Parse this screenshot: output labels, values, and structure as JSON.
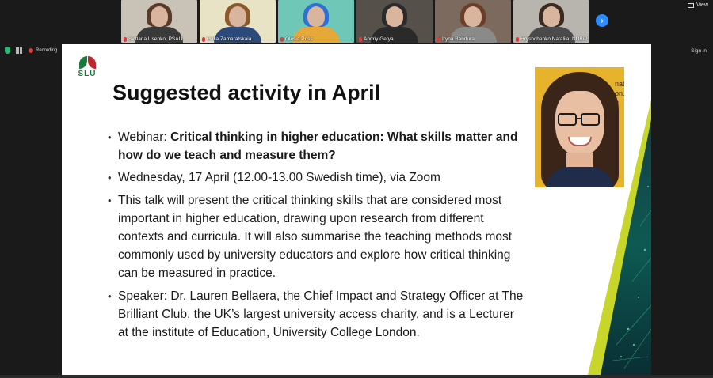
{
  "window": {
    "view_label": "View",
    "sign_in": "Sign in",
    "recording_label": "Recording"
  },
  "participants": [
    {
      "name": "Svitlana Usenko, PSAU",
      "bg": "#c9c2b6",
      "hair": "#5a3b2a",
      "body": "#3a3a3a"
    },
    {
      "name": "Galia Zamaratskaia",
      "bg": "#e9e3c6",
      "hair": "#8a5a2b",
      "body": "#2b4a7a"
    },
    {
      "name": "Olesia Priss",
      "bg": "#6fc7b8",
      "hair": "#2f6fd6",
      "body": "#e7a83a"
    },
    {
      "name": "Andriy Getya",
      "bg": "#55504a",
      "hair": "#2b2b2b",
      "body": "#2a2a2a"
    },
    {
      "name": "Iryna Bandura",
      "bg": "#7b6a5d",
      "hair": "#6a3e2a",
      "body": "#8a8a88"
    },
    {
      "name": "Hryshchenko Nataliia, NUBiP",
      "bg": "#b8b4ae",
      "hair": "#3a2b22",
      "body": "#4a4a4a"
    }
  ],
  "slide": {
    "logo_text": "SLU",
    "title": "Suggested activity in April",
    "webinar_prefix": "Webinar: ",
    "webinar_title": "Critical thinking in higher education: What skills matter and how do we teach and measure them?",
    "date": "Wednesday, 17 April (12.00-13.00 Swedish time), via Zoom",
    "description": "This talk will present the critical thinking skills that are considered most important in higher education, drawing upon research from different contexts and curricula. It will also summarise the teaching methods most commonly used by university educators and explore how critical thinking can be measured in practice.",
    "speaker": "Speaker: Dr. Lauren Bellaera, the Chief Impact and Strategy Officer at The Brilliant Club, the UK’s largest university access charity, and is a Lecturer at the institute of Education, University College London.",
    "photo_bg_text": "nat on. g"
  },
  "colors": {
    "slu_green": "#1a7a3c",
    "slu_red": "#c0262d",
    "zoom_blue": "#2d8cff",
    "accent_lime": "#c8d62c",
    "deco_dark": "#0f3a3f"
  }
}
